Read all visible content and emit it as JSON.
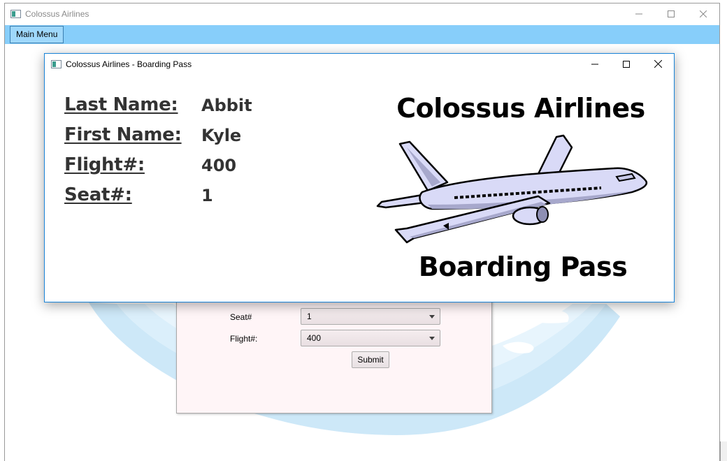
{
  "main_window": {
    "title": "Colossus Airlines",
    "menu": {
      "main_menu_label": "Main Menu"
    }
  },
  "form": {
    "seat_label": "Seat#",
    "seat_value": "1",
    "flight_label": "Flight#:",
    "flight_value": "400",
    "submit_label": "Submit"
  },
  "dialog": {
    "title": "Colossus Airlines - Boarding Pass",
    "fields": [
      {
        "label": "Last Name:",
        "value": "Abbit"
      },
      {
        "label": "First Name:",
        "value": "Kyle"
      },
      {
        "label": "Flight#:",
        "value": "400"
      },
      {
        "label": "Seat#:",
        "value": "1"
      }
    ],
    "brand_title": "Colossus Airlines",
    "pass_title": "Boarding Pass"
  },
  "icons": {
    "app": "window-app-icon",
    "minimize": "minimize-icon",
    "maximize": "maximize-icon",
    "close": "close-icon",
    "dropdown": "chevron-down-icon",
    "airplane": "airplane-illustration"
  },
  "colors": {
    "menubar": "#87cefa",
    "dialog_border": "#1883d7",
    "form_background": "#fff5f7",
    "field_text": "#333333"
  }
}
